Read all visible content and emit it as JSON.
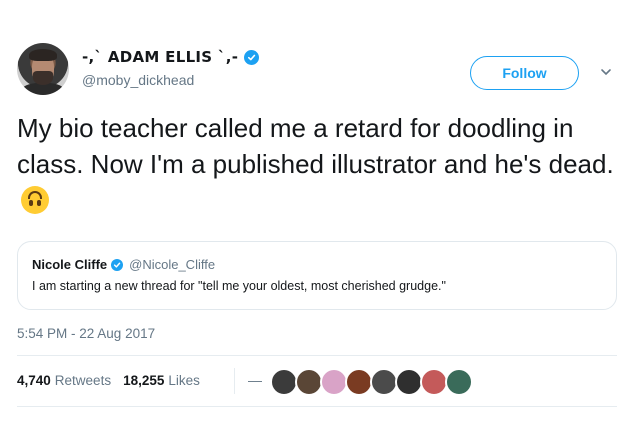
{
  "author": {
    "display_name": "-,` ADAM ELLIS `,-",
    "handle": "@moby_dickhead",
    "verified": true
  },
  "actions": {
    "follow_label": "Follow"
  },
  "tweet": {
    "text": "My bio teacher called me a retard for doodling in class. Now I'm a published illustrator and he's dead.",
    "emoji": "upside-down-face"
  },
  "quoted_tweet": {
    "name": "Nicole Cliffe",
    "handle": "@Nicole_Cliffe",
    "verified": true,
    "text": "I am starting a new thread for \"tell me your oldest, most cherished grudge.\""
  },
  "timestamp": "5:54 PM - 22 Aug 2017",
  "stats": {
    "retweets_count": "4,740",
    "retweets_label": "Retweets",
    "likes_count": "18,255",
    "likes_label": "Likes"
  },
  "liker_avatars": [
    "#3b3b3b",
    "#5a4636",
    "#d9a3c7",
    "#7a3b22",
    "#4b4b4b",
    "#2f2f2f",
    "#c45a5a",
    "#3a6b5a"
  ],
  "colors": {
    "accent": "#1da1f2",
    "secondary_text": "#657786",
    "primary_text": "#14171a"
  }
}
